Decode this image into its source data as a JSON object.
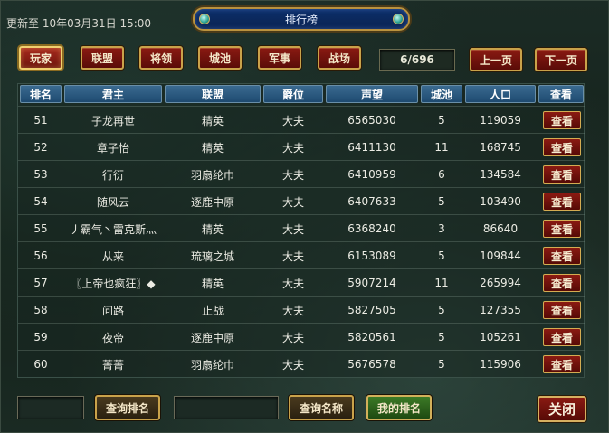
{
  "header": {
    "updated_label": "更新至 10年03月31日 15:00",
    "title": "排行榜"
  },
  "tabs": [
    {
      "label": "玩家",
      "active": true
    },
    {
      "label": "联盟",
      "active": false
    },
    {
      "label": "将领",
      "active": false
    },
    {
      "label": "城池",
      "active": false
    },
    {
      "label": "军事",
      "active": false
    },
    {
      "label": "战场",
      "active": false
    }
  ],
  "pagination": {
    "page_indicator": "6/696",
    "prev_label": "上一页",
    "next_label": "下一页"
  },
  "table": {
    "columns": [
      "排名",
      "君主",
      "联盟",
      "爵位",
      "声望",
      "城池",
      "人口",
      "查看"
    ],
    "view_label": "查看",
    "rows": [
      [
        "51",
        "子龙再世",
        "精英",
        "大夫",
        "6565030",
        "5",
        "119059"
      ],
      [
        "52",
        "章子怡",
        "精英",
        "大夫",
        "6411130",
        "11",
        "168745"
      ],
      [
        "53",
        "行衍",
        "羽扇纶巾",
        "大夫",
        "6410959",
        "6",
        "134584"
      ],
      [
        "54",
        "随风云",
        "逐鹿中原",
        "大夫",
        "6407633",
        "5",
        "103490"
      ],
      [
        "55",
        "丿霸气丶雷克斯灬",
        "精英",
        "大夫",
        "6368240",
        "3",
        "86640"
      ],
      [
        "56",
        "从来",
        "琉璃之城",
        "大夫",
        "6153089",
        "5",
        "109844"
      ],
      [
        "57",
        "〖上帝也疯狂〗◆",
        "精英",
        "大夫",
        "5907214",
        "11",
        "265994"
      ],
      [
        "58",
        "问路",
        "止战",
        "大夫",
        "5827505",
        "5",
        "127355"
      ],
      [
        "59",
        "夜帝",
        "逐鹿中原",
        "大夫",
        "5820561",
        "5",
        "105261"
      ],
      [
        "60",
        "菁菁",
        "羽扇纶巾",
        "大夫",
        "5676578",
        "5",
        "115906"
      ]
    ]
  },
  "footer": {
    "rank_input_value": "",
    "query_rank_label": "查询排名",
    "name_input_value": "",
    "query_name_label": "查询名称",
    "my_rank_label": "我的排名",
    "close_label": "关闭"
  }
}
